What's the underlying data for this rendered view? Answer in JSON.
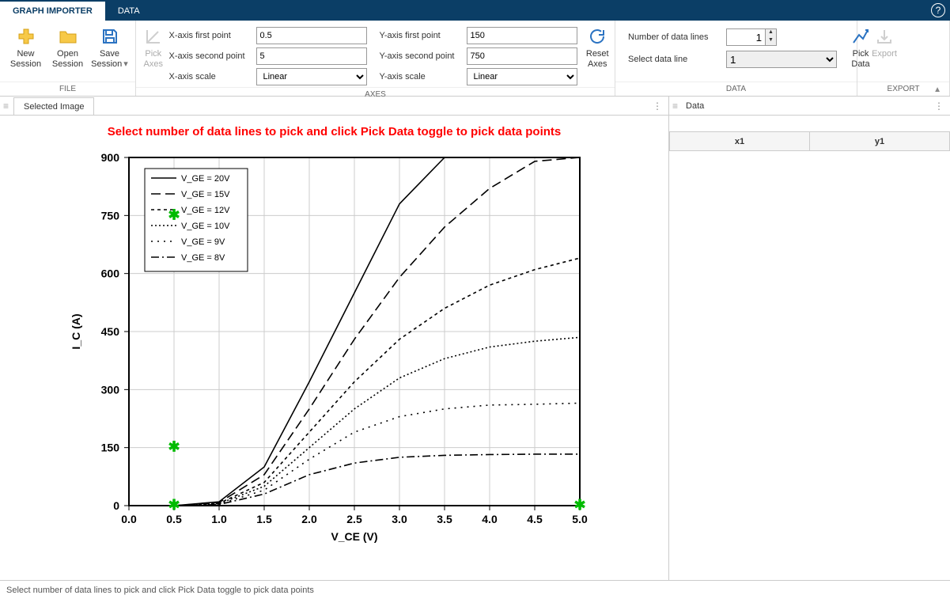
{
  "tabs": {
    "graph_importer": "GRAPH IMPORTER",
    "data": "DATA"
  },
  "help_icon": "?",
  "ribbon": {
    "file": {
      "label": "FILE",
      "new": "New\nSession",
      "open": "Open\nSession",
      "save": "Save\nSession"
    },
    "axes": {
      "label": "AXES",
      "pick": "Pick\nAxes",
      "reset": "Reset\nAxes",
      "x_first_label": "X-axis first point",
      "x_first_val": "0.5",
      "x_second_label": "X-axis second point",
      "x_second_val": "5",
      "x_scale_label": "X-axis scale",
      "x_scale_val": "Linear",
      "y_first_label": "Y-axis first point",
      "y_first_val": "150",
      "y_second_label": "Y-axis second point",
      "y_second_val": "750",
      "y_scale_label": "Y-axis scale",
      "y_scale_val": "Linear"
    },
    "data": {
      "label": "DATA",
      "num_lines_label": "Number of data lines",
      "num_lines_val": "1",
      "select_line_label": "Select data line",
      "select_line_val": "1",
      "pick": "Pick\nData"
    },
    "export": {
      "label": "EXPORT",
      "export": "Export"
    }
  },
  "left": {
    "tab_label": "Selected Image",
    "instruction": "Select number of data lines to pick and click Pick Data toggle to pick data points"
  },
  "right": {
    "tab_label": "Data",
    "cols": [
      "x1",
      "y1"
    ]
  },
  "status_text": "Select number of data lines to pick and click Pick Data toggle to pick data points",
  "chart_data": {
    "type": "line",
    "title": "",
    "xlabel": "V_CE (V)",
    "ylabel": "I_C (A)",
    "xlim": [
      0.0,
      5.0
    ],
    "ylim": [
      0,
      900
    ],
    "x_ticks": [
      "0.0",
      "0.5",
      "1.0",
      "1.5",
      "2.0",
      "2.5",
      "3.0",
      "3.5",
      "4.0",
      "4.5",
      "5.0"
    ],
    "y_ticks": [
      "0",
      "150",
      "300",
      "450",
      "600",
      "750",
      "900"
    ],
    "legend_labels": [
      "V_GE = 20V",
      "V_GE = 15V",
      "V_GE = 12V",
      "V_GE = 10V",
      "V_GE = 9V",
      "V_GE = 8V"
    ],
    "x": [
      0.0,
      0.5,
      1.0,
      1.5,
      2.0,
      2.5,
      3.0,
      3.5,
      4.0,
      4.5,
      5.0
    ],
    "series": [
      {
        "name": "V_GE = 20V",
        "values": [
          0,
          0,
          10,
          100,
          320,
          550,
          780,
          900,
          900,
          900,
          900
        ]
      },
      {
        "name": "V_GE = 15V",
        "values": [
          0,
          0,
          8,
          80,
          250,
          430,
          590,
          720,
          820,
          890,
          900
        ]
      },
      {
        "name": "V_GE = 12V",
        "values": [
          0,
          0,
          6,
          60,
          190,
          320,
          430,
          510,
          570,
          610,
          640
        ]
      },
      {
        "name": "V_GE = 10V",
        "values": [
          0,
          0,
          5,
          50,
          150,
          250,
          330,
          380,
          410,
          425,
          435
        ]
      },
      {
        "name": "V_GE = 9V",
        "values": [
          0,
          0,
          4,
          40,
          120,
          190,
          230,
          250,
          260,
          262,
          265
        ]
      },
      {
        "name": "V_GE = 8V",
        "values": [
          0,
          0,
          3,
          30,
          80,
          110,
          125,
          130,
          132,
          133,
          133
        ]
      }
    ],
    "calibration_points": [
      {
        "vx": 0.5,
        "vy": 0
      },
      {
        "vx": 5.0,
        "vy": 0
      },
      {
        "vx": 0.5,
        "vy": 150
      },
      {
        "vx": 0.5,
        "vy": 750
      }
    ]
  }
}
